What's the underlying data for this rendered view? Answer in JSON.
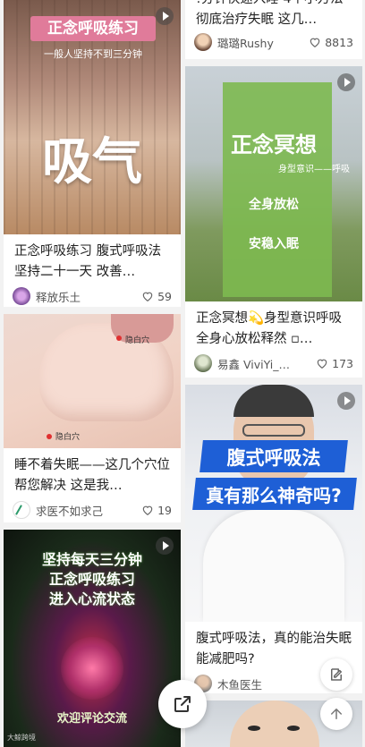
{
  "cards": [
    {
      "thumb_top": "正念呼吸练习",
      "thumb_sub": "一般人坚持不到三分钟",
      "thumb_big": "吸气",
      "title": "正念呼吸练习 腹式呼吸法 坚持二十一天 改善…",
      "author": "释放乐土",
      "likes": "59",
      "avatar_icon": "lotus-avatar-icon"
    },
    {
      "thumb_label1": "隐白穴",
      "thumb_label2": "隐白穴",
      "title": "睡不着失眠——这几个穴位帮您解决 这是我…",
      "author": "求医不如求己",
      "likes": "19",
      "avatar_icon": "acupuncture-avatar-icon"
    },
    {
      "thumb_line1": "坚持每天三分钟",
      "thumb_line2": "正念呼吸练习",
      "thumb_line3": "进入心流状态",
      "thumb_bottom": "欢迎评论交流",
      "thumb_watermark": "大鲸跨境"
    },
    {
      "title": "!分钟快速入睡 4个小方法彻底治疗失眠 这几…",
      "author": "璐璐Rushy",
      "likes": "8813"
    },
    {
      "thumb_big": "正念冥想",
      "thumb_sub": "身型意识——呼吸",
      "thumb_line1": "全身放松",
      "thumb_line2": "安稳入眠",
      "title": "正念冥想💫身型意识呼吸 全身心放松释然 ▫…",
      "author": "易鑫 ViviYi_…",
      "likes": "173"
    },
    {
      "thumb_line1": "腹式呼吸法",
      "thumb_line2": "真有那么神奇吗?",
      "title": "腹式呼吸法，真的能治失眠能减肥吗?",
      "author": "木鱼医生",
      "likes": ""
    }
  ],
  "floating": {
    "share_icon": "share-icon",
    "edit_icon": "edit-note-icon",
    "top_icon": "back-to-top-icon"
  },
  "colors": {
    "accent_green": "#6fb04a",
    "blue_banner": "#1e5fd6"
  }
}
